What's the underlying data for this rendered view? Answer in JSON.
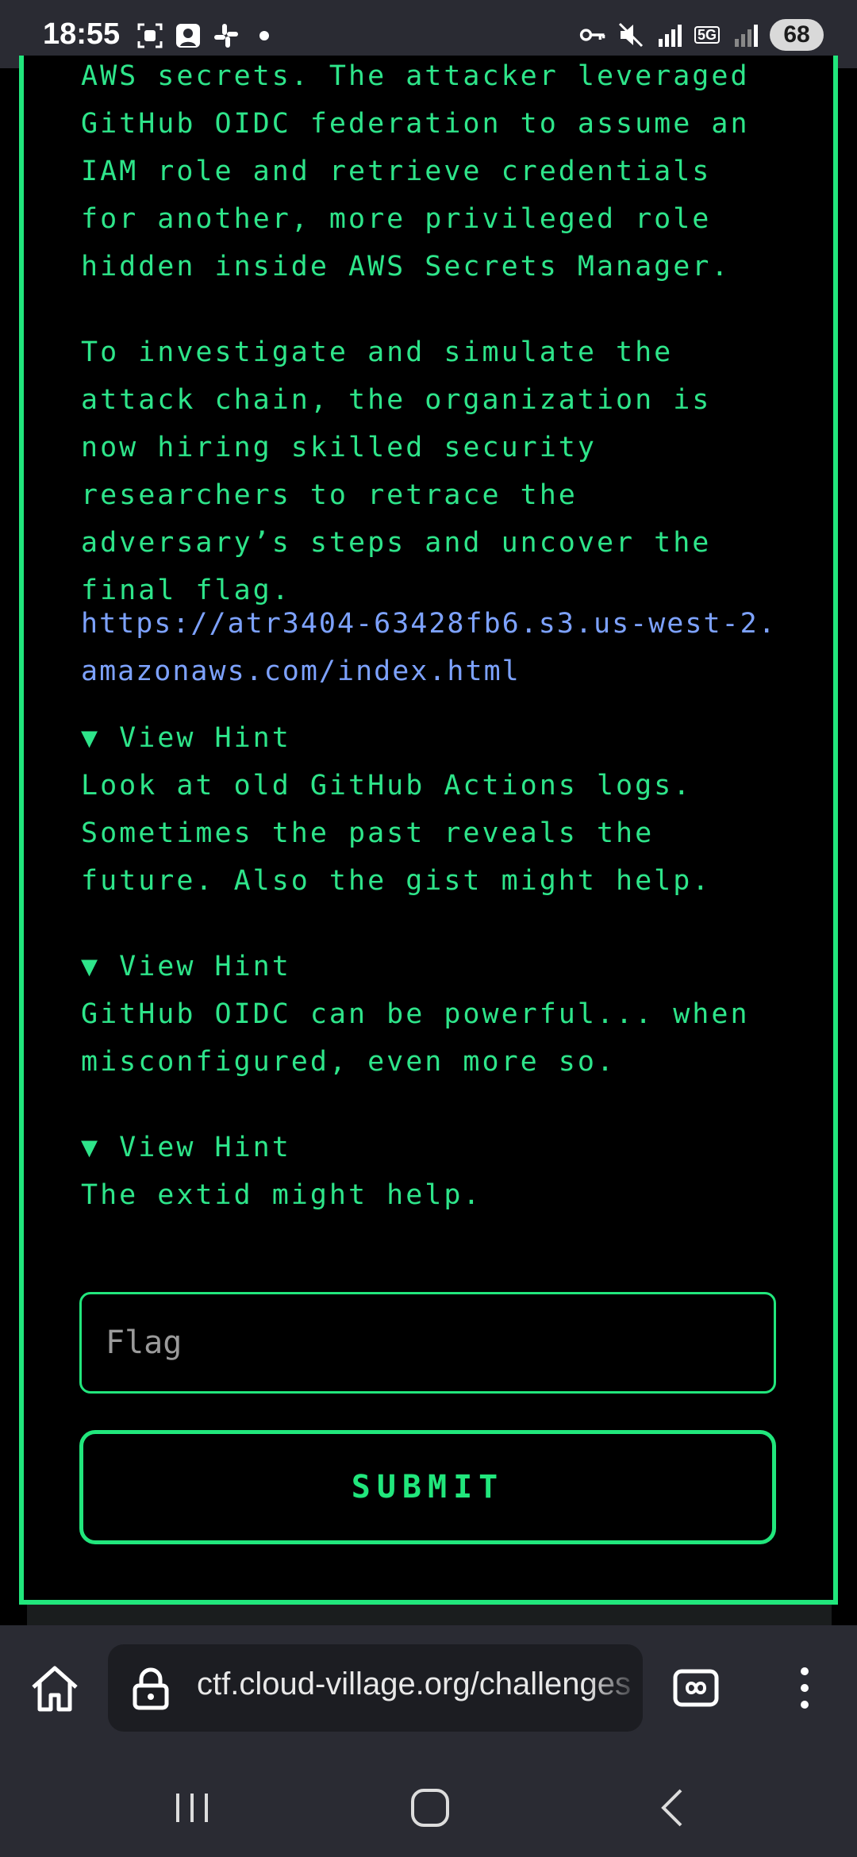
{
  "status_bar": {
    "time": "18:55",
    "battery": "68",
    "left_icons": [
      "screenshot-icon",
      "photo-icon",
      "slack-icon",
      "dot-icon"
    ],
    "right_icons": [
      "vpn-key-icon",
      "mute-icon",
      "signal-icon",
      "5g-icon",
      "signal-icon"
    ],
    "network_label": "5G"
  },
  "challenge": {
    "paragraph_1": "AWS secrets. The attacker leveraged GitHub OIDC federation to assume an IAM role and retrieve credentials for another, more privileged role hidden inside AWS Secrets Manager.",
    "paragraph_2": "To investigate and simulate the attack chain, the organization is now hiring skilled security researchers to retrace the adversary’s steps and uncover the final flag.",
    "link": "https://atr3404-63428fb6.s3.us-west-2.amazonaws.com/index.html",
    "hints": [
      {
        "toggle": "▼ View Hint",
        "text": "Look at old GitHub Actions logs. Sometimes the past reveals the future. Also the gist might help."
      },
      {
        "toggle": "▼ View Hint",
        "text": "GitHub OIDC can be powerful... when misconfigured, even more so."
      },
      {
        "toggle": "▼ View Hint",
        "text": "The extid might help."
      }
    ],
    "flag_placeholder": "Flag",
    "submit_label": "SUBMIT"
  },
  "browser": {
    "url": "ctf.cloud-village.org/challenges"
  },
  "colors": {
    "accent": "#21e67c",
    "text": "#2ee58a",
    "link": "#7da2ff",
    "background": "#000000",
    "chrome": "#2a2b33"
  }
}
